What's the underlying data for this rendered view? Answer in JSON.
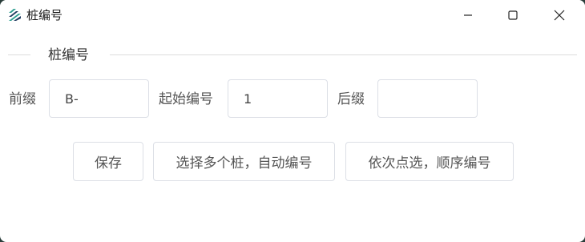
{
  "window": {
    "title": "桩编号",
    "icon": "pile-logo-icon",
    "controls": [
      "minimize-icon",
      "maximize-icon",
      "close-icon"
    ]
  },
  "group": {
    "title": "桩编号"
  },
  "form": {
    "prefix": {
      "label": "前缀",
      "value": "B-"
    },
    "start_number": {
      "label": "起始编号",
      "value": "1"
    },
    "suffix": {
      "label": "后缀",
      "value": ""
    }
  },
  "actions": {
    "save_label": "保存",
    "multi_select_label": "选择多个桩，自动编号",
    "sequential_label": "依次点选，顺序编号"
  },
  "colors": {
    "border": "#dcdfe6",
    "text": "#555555",
    "icon_teal": "#2a9d8f",
    "icon_navy": "#1f3a5f"
  }
}
